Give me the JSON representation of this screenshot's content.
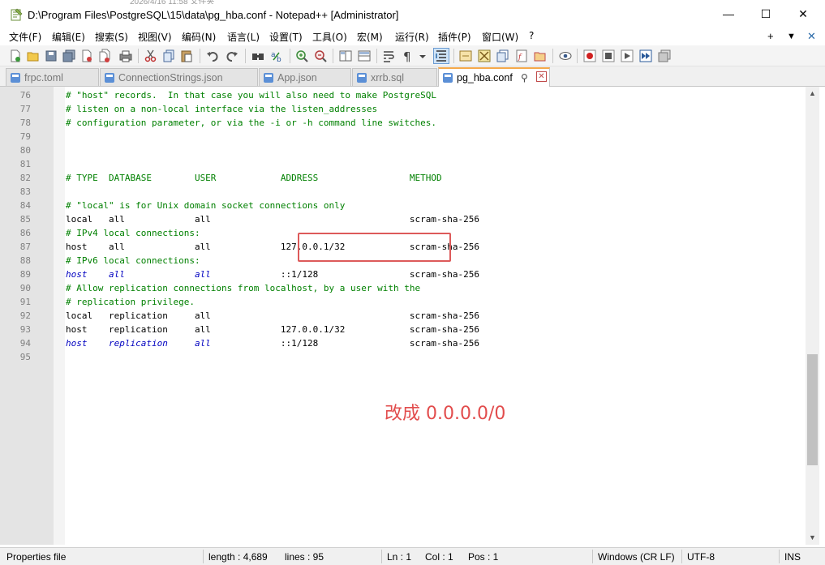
{
  "window": {
    "title": "D:\\Program Files\\PostgreSQL\\15\\data\\pg_hba.conf - Notepad++ [Administrator]",
    "background_strip": "2026/4/16 11:58          文件夹",
    "controls": {
      "minimize": "—",
      "maximize": "☐",
      "close": "✕"
    }
  },
  "menu": {
    "items": [
      "文件(F)",
      "编辑(E)",
      "搜索(S)",
      "视图(V)",
      "编码(N)",
      "语言(L)",
      "设置(T)",
      "工具(O)",
      "宏(M)",
      "运行(R)",
      "插件(P)",
      "窗口(W)",
      "?"
    ],
    "right": {
      "add": "+",
      "dropdown": "▼",
      "close": "✕"
    }
  },
  "toolbar": {
    "icons": [
      "new-file-icon",
      "open-folder-icon",
      "save-icon",
      "save-all-icon",
      "close-icon",
      "close-all-icon",
      "print-icon",
      "cut-icon",
      "copy-icon",
      "paste-icon",
      "undo-icon",
      "redo-icon",
      "find-icon",
      "replace-icon",
      "zoom-in-icon",
      "zoom-out-icon",
      "sync-vertical-icon",
      "sync-horizontal-icon",
      "word-wrap-icon",
      "show-all-chars-icon",
      "dropdown-icon",
      "indent-guide-icon",
      "udl-icon",
      "doc-map-icon",
      "doc-list-icon",
      "function-list-icon",
      "folder-workspace-icon",
      "monitor-icon",
      "record-macro-icon",
      "stop-macro-icon",
      "play-macro-icon",
      "run-macro-multiple-icon",
      "save-macro-icon"
    ]
  },
  "tabs": [
    {
      "label": "frpc.toml",
      "active": false
    },
    {
      "label": "ConnectionStrings.json",
      "active": false
    },
    {
      "label": "App.json",
      "active": false
    },
    {
      "label": "xrrb.sql",
      "active": false
    },
    {
      "label": "pg_hba.conf",
      "active": true,
      "pin": "⚲",
      "close": "✕"
    }
  ],
  "editor": {
    "lines": [
      {
        "num": "76",
        "text": "# \"host\" records.  In that case you will also need to make PostgreSQL",
        "style": "comment"
      },
      {
        "num": "77",
        "text": "# listen on a non-local interface via the listen_addresses",
        "style": "comment"
      },
      {
        "num": "78",
        "text": "# configuration parameter, or via the -i or -h command line switches.",
        "style": "comment"
      },
      {
        "num": "79",
        "text": "",
        "style": "plain"
      },
      {
        "num": "80",
        "text": "",
        "style": "plain"
      },
      {
        "num": "81",
        "text": "",
        "style": "plain"
      },
      {
        "num": "82",
        "text": "# TYPE  DATABASE        USER            ADDRESS                 METHOD",
        "style": "comment"
      },
      {
        "num": "83",
        "text": "",
        "style": "plain"
      },
      {
        "num": "84",
        "text": "# \"local\" is for Unix domain socket connections only",
        "style": "comment"
      },
      {
        "num": "85",
        "text": "local   all             all                                     scram-sha-256",
        "style": "plain"
      },
      {
        "num": "86",
        "text": "# IPv4 local connections:",
        "style": "comment"
      },
      {
        "num": "87",
        "text": "host    all             all             127.0.0.1/32            scram-sha-256",
        "style": "plain"
      },
      {
        "num": "88",
        "text": "# IPv6 local connections:",
        "style": "comment"
      },
      {
        "num": "89",
        "text": "host    all             all             ::1/128                 scram-sha-256",
        "style": "mixed"
      },
      {
        "num": "90",
        "text": "# Allow replication connections from localhost, by a user with the",
        "style": "comment"
      },
      {
        "num": "91",
        "text": "# replication privilege.",
        "style": "comment"
      },
      {
        "num": "92",
        "text": "local   replication     all                                     scram-sha-256",
        "style": "plain"
      },
      {
        "num": "93",
        "text": "host    replication     all             127.0.0.1/32            scram-sha-256",
        "style": "plain"
      },
      {
        "num": "94",
        "text": "host    replication     all             ::1/128                 scram-sha-256",
        "style": "mixed"
      },
      {
        "num": "95",
        "text": "",
        "style": "plain"
      }
    ],
    "annotation": "改成 0.0.0.0/0"
  },
  "status": {
    "file_type": "Properties file",
    "length": "length : 4,689",
    "lines": "lines : 95",
    "ln": "Ln : 1",
    "col": "Col : 1",
    "pos": "Pos : 1",
    "eol": "Windows (CR LF)",
    "encoding": "UTF-8",
    "mode": "INS"
  },
  "colors": {
    "comment": "#008000",
    "keyword_italic": "#0000c0",
    "annotation_red": "#e24d4d",
    "active_tab_accent": "#f5a94a"
  }
}
